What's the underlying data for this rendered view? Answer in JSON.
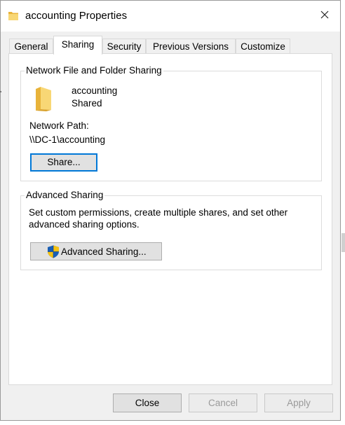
{
  "window": {
    "title": "accounting Properties"
  },
  "tabs": [
    {
      "label": "General",
      "active": false
    },
    {
      "label": "Sharing",
      "active": true
    },
    {
      "label": "Security",
      "active": false
    },
    {
      "label": "Previous Versions",
      "active": false
    },
    {
      "label": "Customize",
      "active": false
    }
  ],
  "network_sharing": {
    "group_label": "Network File and Folder Sharing",
    "folder_name": "accounting",
    "status": "Shared",
    "path_label": "Network Path:",
    "path_value": "\\\\DC-1\\accounting",
    "share_button": "Share..."
  },
  "advanced_sharing": {
    "group_label": "Advanced Sharing",
    "description_line1": "Set custom permissions, create multiple shares, and set other",
    "description_line2": "advanced sharing options.",
    "button_label": "Advanced Sharing..."
  },
  "footer": {
    "close_label": "Close",
    "cancel_label": "Cancel",
    "apply_label": "Apply"
  },
  "colors": {
    "accent": "#0078d7",
    "folder_yellow": "#f4c94e",
    "disabled_text": "#9a9a9a"
  },
  "icons": [
    "folder-icon",
    "close-icon",
    "uac-shield-icon"
  ]
}
